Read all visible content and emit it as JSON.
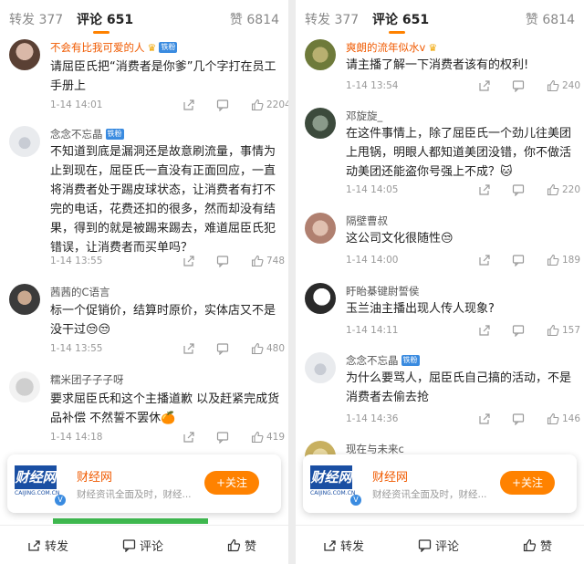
{
  "left": {
    "tabs": {
      "repost": "转发 377",
      "comments": "评论 651",
      "likes": "赞 6814"
    },
    "comments": [
      {
        "user": "不会有比我可爱的人",
        "text": "请屈臣氏把“消费者是你爹”几个字打在员工手册上",
        "time": "1-14 14:01",
        "likes": "2204"
      },
      {
        "user": "念念不忘晶",
        "text": "不知道到底是漏洞还是故意刷流量，事情为止到现在，屈臣氏一直没有正面回应，一直将消费者处于踢皮球状态，让消费者有打不完的电话，花费还扣的很多，然而却没有结果，得到的就是被踢来踢去，难道屈臣氏犯错误，让消费者而买单吗？",
        "time": "1-14 13:55",
        "likes": "748"
      },
      {
        "user": "茜茜的C语言",
        "text": "标一个促销价，结算时原价，实体店又不是没干过😒😒",
        "time": "1-14 13:55",
        "likes": "480"
      },
      {
        "user": "糯米团子子子呀",
        "text": "要求屈臣氏和这个主播道歉 以及赶紧完成货品补偿 不然誓不罢休🍊",
        "time": "1-14 14:18",
        "likes": "419"
      }
    ],
    "promo": {
      "name": "财经网",
      "desc": "财经资讯全面及时，财经...",
      "follow": "+关注",
      "logo": "财经网",
      "logo_sub": "CAIJING.COM.CN"
    },
    "bottom": {
      "repost": "转发",
      "comment": "评论",
      "like": "赞"
    }
  },
  "right": {
    "tabs": {
      "repost": "转发 377",
      "comments": "评论 651",
      "likes": "赞 6814"
    },
    "comments": [
      {
        "user": "爽朗的流年似水v",
        "text": "请主播了解一下消费者该有的权利!",
        "time": "1-14 13:54",
        "likes": "240"
      },
      {
        "user": "邓旋旋_",
        "text": "在这件事情上，除了屈臣氏一个劲儿往美团上甩锅，明眼人都知道美团没错，你不做活动美团还能盗你号强上不成？🐱",
        "time": "1-14 14:05",
        "likes": "220"
      },
      {
        "user": "隔壁曹叔",
        "text": "这公司文化很随性😒",
        "time": "1-14 14:00",
        "likes": "189"
      },
      {
        "user": "盱眙棊键尉誓侯",
        "text": "玉兰油主播出现人传人现象?",
        "time": "1-14 14:11",
        "likes": "157"
      },
      {
        "user": "念念不忘晶",
        "text": "为什么要骂人，屈臣氏自己搞的活动，不是消费者去偷去抢",
        "time": "1-14 14:36",
        "likes": "146"
      },
      {
        "user": "现在与未来c",
        "text": "",
        "time": "",
        "likes": ""
      }
    ],
    "promo": {
      "name": "财经网",
      "desc": "财经资讯全面及时，财经...",
      "follow": "+关注",
      "logo": "财经网",
      "logo_sub": "CAIJING.COM.CN"
    },
    "bottom": {
      "repost": "转发",
      "comment": "评论",
      "like": "赞"
    }
  },
  "badge_text": "铁粉",
  "colors": {
    "accent": "#ff8200",
    "vip_name": "#f05a00",
    "badge": "#3a8be0",
    "logo": "#1a4fa3"
  },
  "icons": [
    "share-icon",
    "reply-icon",
    "like-icon",
    "repost-icon",
    "comment-icon",
    "thumb-icon",
    "crown-icon"
  ]
}
